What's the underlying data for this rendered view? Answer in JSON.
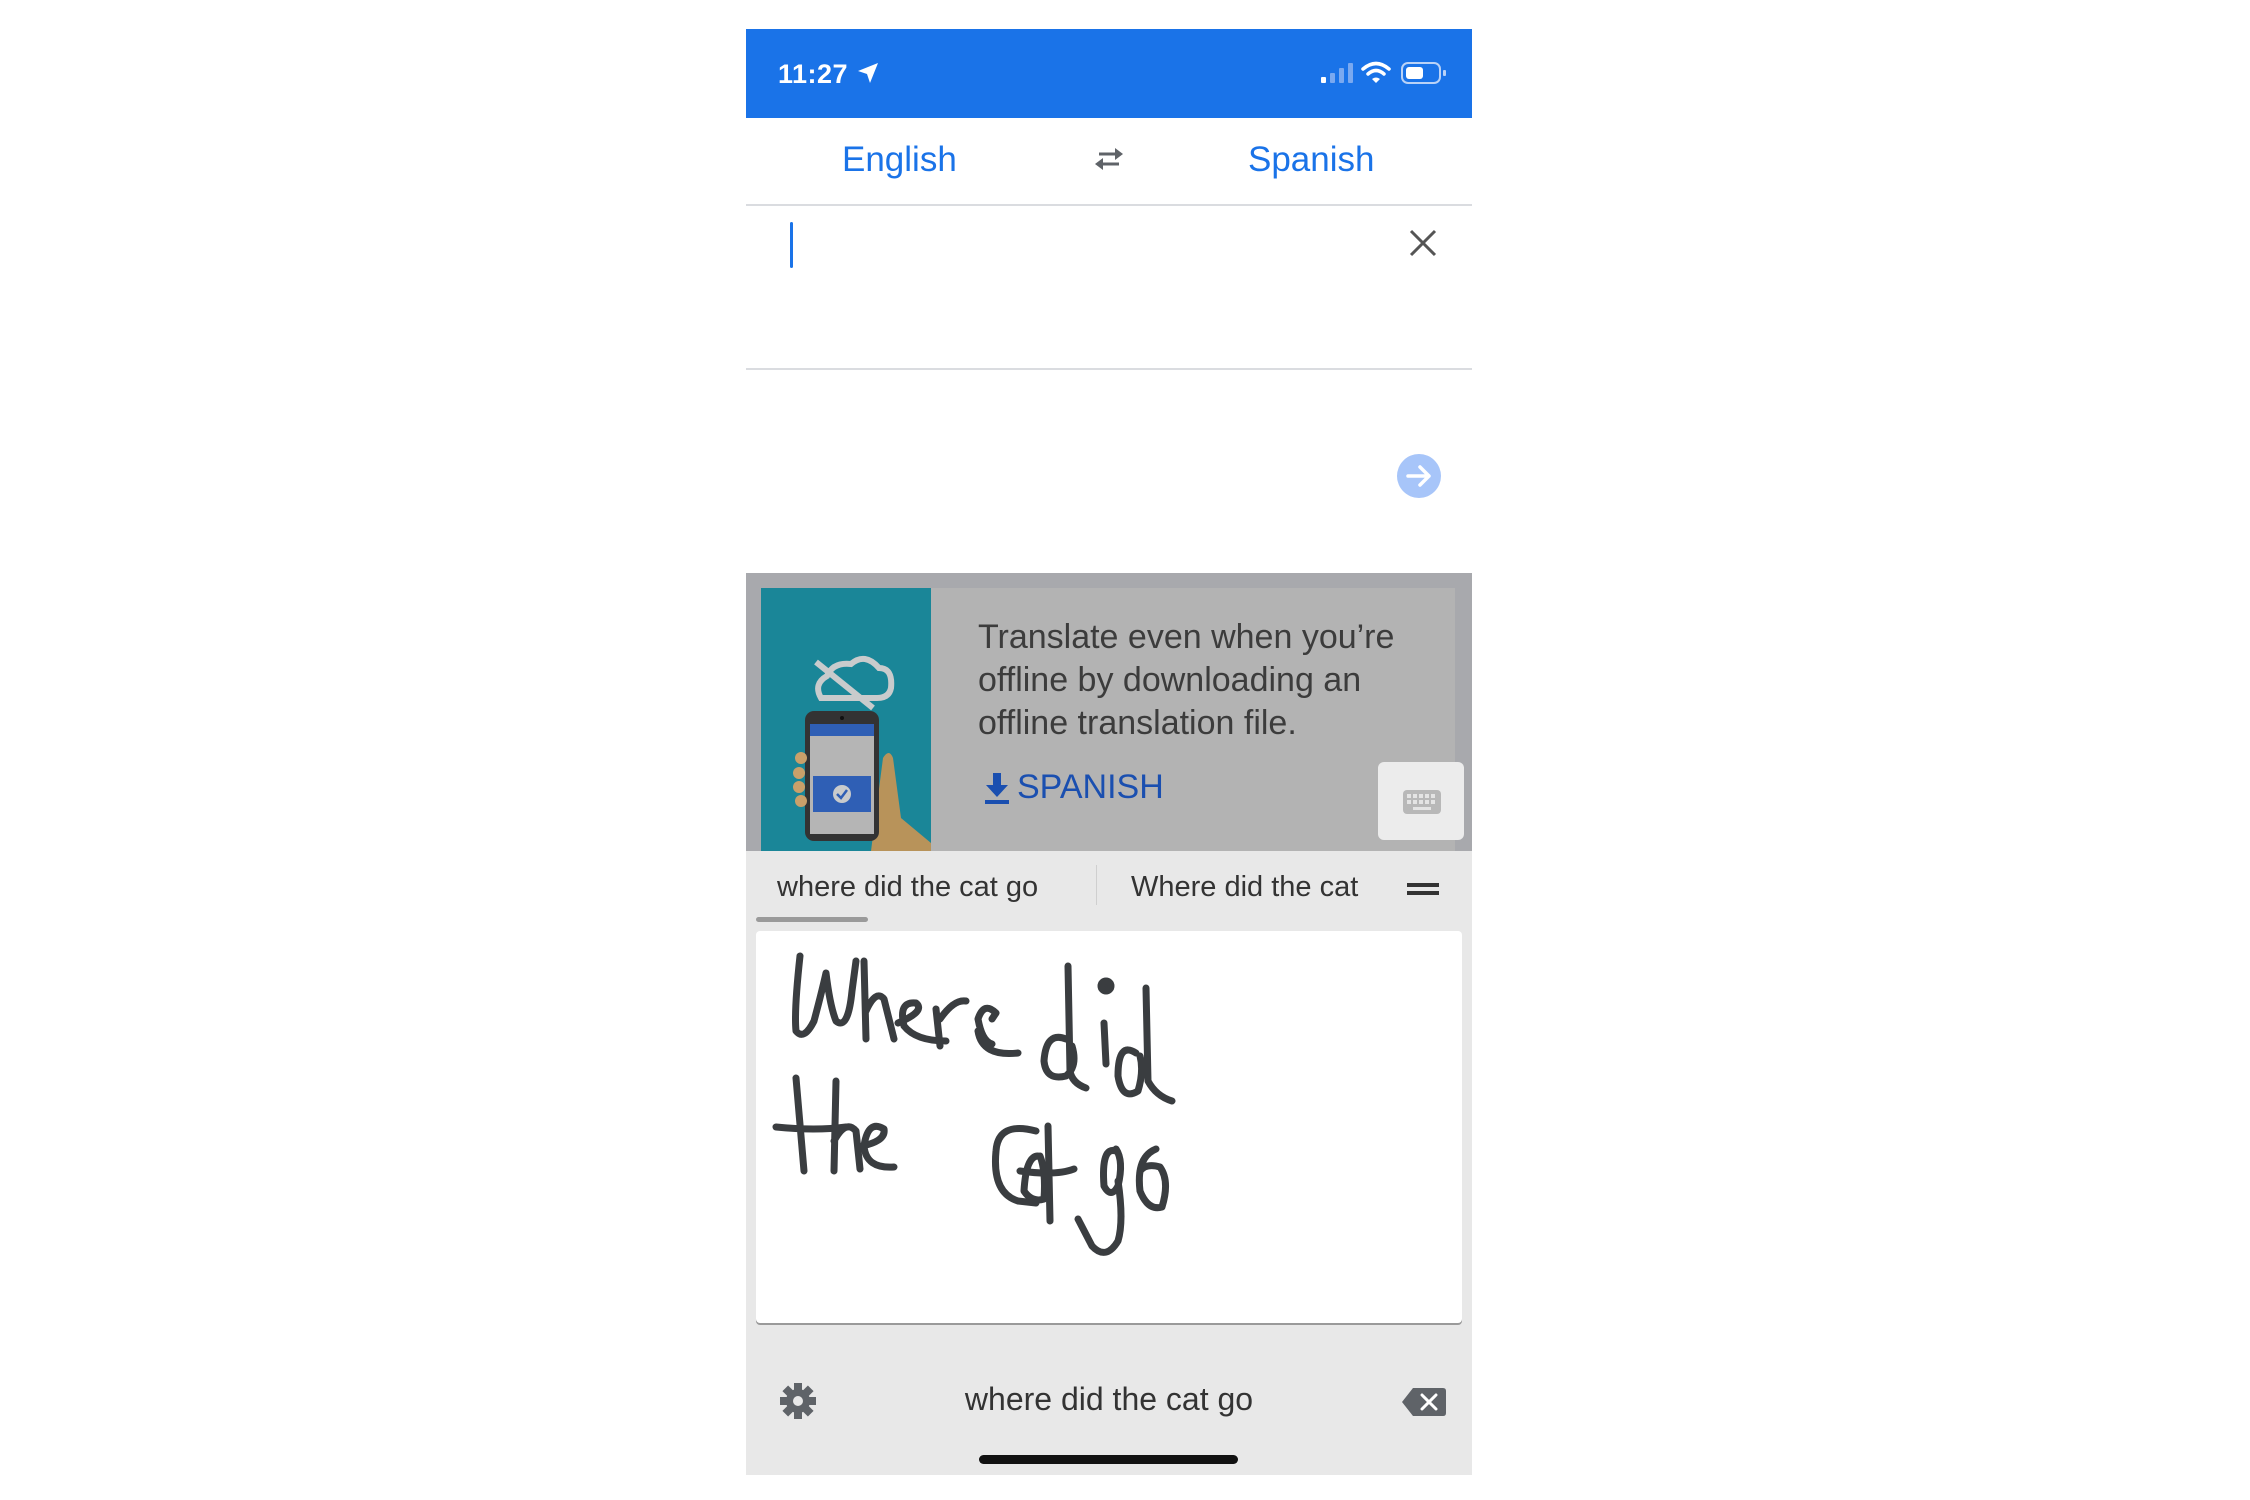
{
  "status_bar": {
    "time": "11:27",
    "icons": [
      "location-arrow-icon",
      "cellular-signal-icon",
      "wifi-icon",
      "battery-icon"
    ]
  },
  "language_bar": {
    "source_language": "English",
    "target_language": "Spanish",
    "swap_icon": "swap-arrows-icon"
  },
  "input": {
    "value": "",
    "clear_icon": "close-icon",
    "submit_icon": "arrow-right-circle-icon"
  },
  "offline_banner": {
    "message": "Translate even when you’re offline by downloading an offline translation file.",
    "download_label": "SPANISH",
    "download_icon": "download-icon",
    "keyboard_icon": "keyboard-icon"
  },
  "handwriting_keyboard": {
    "candidates": [
      "where did the cat go",
      "Where did the cat"
    ],
    "menu_icon": "menu-icon",
    "handwritten_text": "Where did the cat go",
    "composed_text": "where did the cat go",
    "settings_icon": "gear-icon",
    "backspace_icon": "backspace-icon"
  },
  "colors": {
    "brand_blue": "#1a73e8",
    "link_blue": "#1a4fb0",
    "ink": "#3a3d40",
    "teal": "#1a8698"
  }
}
